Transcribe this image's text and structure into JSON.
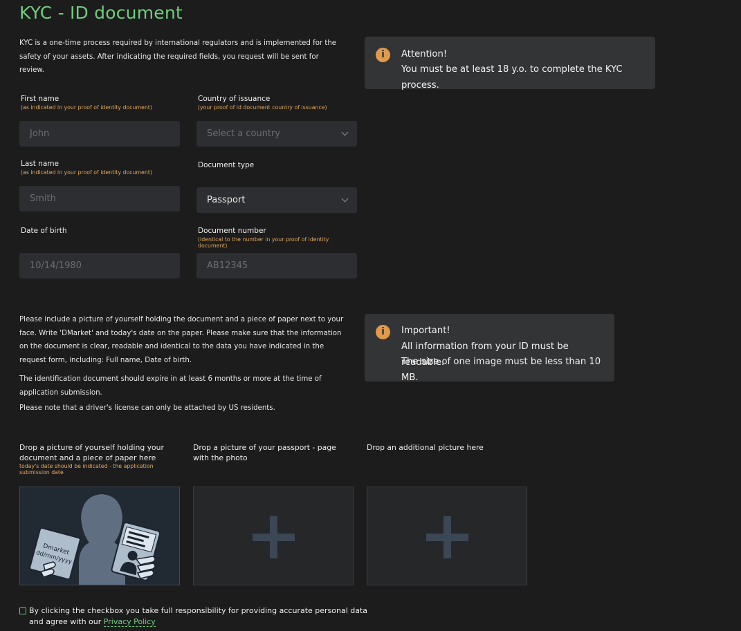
{
  "header": {
    "title": "KYC - ID document"
  },
  "intro": "KYC is a one-time process required by international regulators and is implemented for the safety of your assets. After indicating the required fields, you request will be sent for review.",
  "attention": {
    "title": "Attention!",
    "text": "You must be at least 18 y.o. to complete the KYC process.",
    "icon": "info-icon"
  },
  "form": {
    "first_name": {
      "label": "First name",
      "sub": "(as indicated in your proof of identity document)",
      "placeholder": "John"
    },
    "country": {
      "label": "Country of issuance",
      "sub": "(your proof of id document country of issuance)",
      "placeholder": "Select a country"
    },
    "last_name": {
      "label": "Last name",
      "sub": "(as indicated in your proof of identity document)",
      "placeholder": "Smith"
    },
    "doc_type": {
      "label": "Document type",
      "value": "Passport"
    },
    "dob": {
      "label": "Date of birth",
      "placeholder": "10/14/1980"
    },
    "doc_number": {
      "label": "Document number",
      "sub": "(identical to the number in your proof of identity document)",
      "placeholder": "AB12345"
    }
  },
  "instructions": {
    "p1": "Please include a picture of yourself holding the document and a piece of paper next to your face. Write 'DMarket' and today's date on the paper. Please make sure that the information on the document is clear, readable and identical to the data you have indicated in the request form, including: Full name, Date of birth.",
    "p2": "The identification document should expire in at least 6 months or more at the time of application submission.",
    "p3": "Please note that a driver's license can only be attached by US residents."
  },
  "important": {
    "title": "Important!",
    "line1": "All information from your ID must be readable.",
    "line2": "The size of one image must be less than 10 MB.",
    "icon": "info-icon"
  },
  "uploads": [
    {
      "label": "Drop a picture of yourself holding your document and a piece of paper here",
      "sub": "today's date should be indicated - the application submission date",
      "example_paper_line1": "Dmarket",
      "example_paper_line2": "dd/mm/yyyy"
    },
    {
      "label": "Drop a picture of your passport - page with the photo"
    },
    {
      "label": "Drop an additional picture here"
    }
  ],
  "agreement": {
    "text": "By clicking the checkbox you take full responsibility for providing accurate personal data and agree with our ",
    "link": "Privacy Policy"
  },
  "colors": {
    "accent": "#6fce7b",
    "hint": "#e4a95a",
    "info": "#e09a4c"
  }
}
